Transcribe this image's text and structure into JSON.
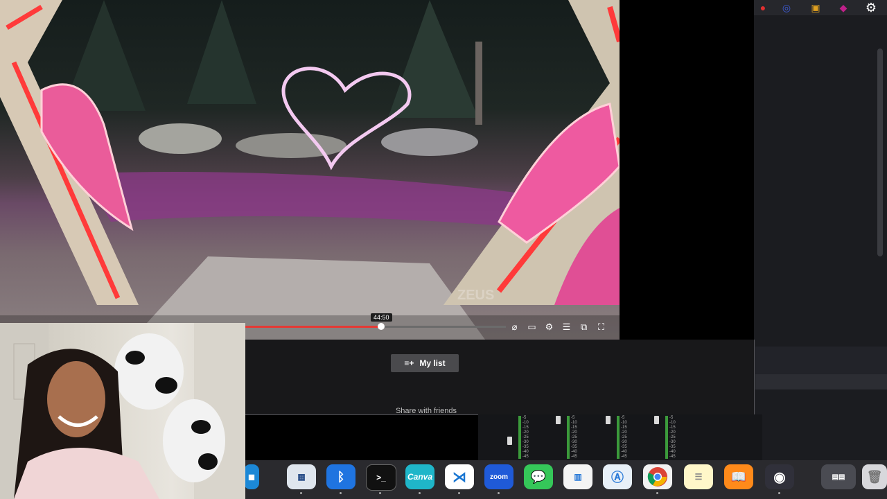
{
  "video": {
    "tooltip_time": "44:50",
    "progress_fraction": 0.52,
    "watermark": "ZEUS",
    "controls": [
      {
        "name": "subtitles-off-icon",
        "glyph": "⌀"
      },
      {
        "name": "cc-icon",
        "glyph": "▭"
      },
      {
        "name": "gear-icon",
        "glyph": "⚙"
      },
      {
        "name": "episodes-icon",
        "glyph": "☰"
      },
      {
        "name": "pip-icon",
        "glyph": "⧉"
      },
      {
        "name": "fullscreen-icon",
        "glyph": "⛶"
      }
    ]
  },
  "below": {
    "my_list_label": "My list",
    "share_label": "Share with friends"
  },
  "mixer": {
    "scale_labels": [
      "-5",
      "-10",
      "-15",
      "-20",
      "-25",
      "-30",
      "-35",
      "-40",
      "-45"
    ]
  },
  "dock": {
    "zoom_label": "zoom",
    "canva_label": "Canva",
    "terminal_label": ">_"
  },
  "colors": {
    "progress": "#e53935",
    "canva": "#1fb6c9",
    "zoom": "#1f5ad8",
    "vscode": "#1976d2"
  }
}
